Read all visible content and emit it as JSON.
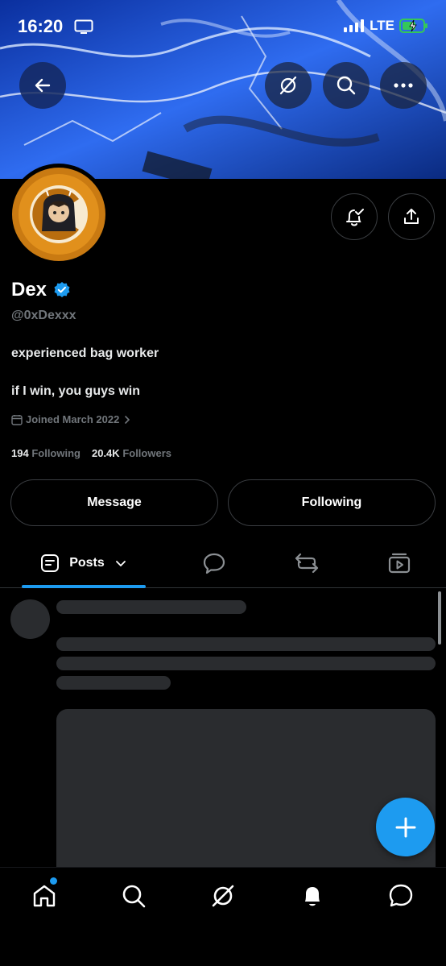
{
  "status_bar": {
    "time": "16:20",
    "network": "LTE"
  },
  "profile": {
    "name": "Dex",
    "handle": "@0xDexxx",
    "bio_line1": "experienced bag worker",
    "bio_line2": "if I win, you guys win",
    "joined": "Joined March 2022",
    "following_count": "194",
    "following_label": "Following",
    "followers_count": "20.4K",
    "followers_label": "Followers",
    "verified": true
  },
  "actions": {
    "message_label": "Message",
    "following_label": "Following"
  },
  "tabs": [
    {
      "label": "Posts",
      "icon": "posts-icon",
      "active": true
    },
    {
      "icon": "replies-icon"
    },
    {
      "icon": "reposts-icon"
    },
    {
      "icon": "media-icon"
    }
  ],
  "bottom_nav": [
    "home-icon",
    "search-icon",
    "grok-icon",
    "notifications-icon",
    "messages-icon"
  ],
  "colors": {
    "accent": "#1d9bf0",
    "background": "#000000",
    "muted": "#71767b",
    "skeleton": "#2a2c2f"
  }
}
